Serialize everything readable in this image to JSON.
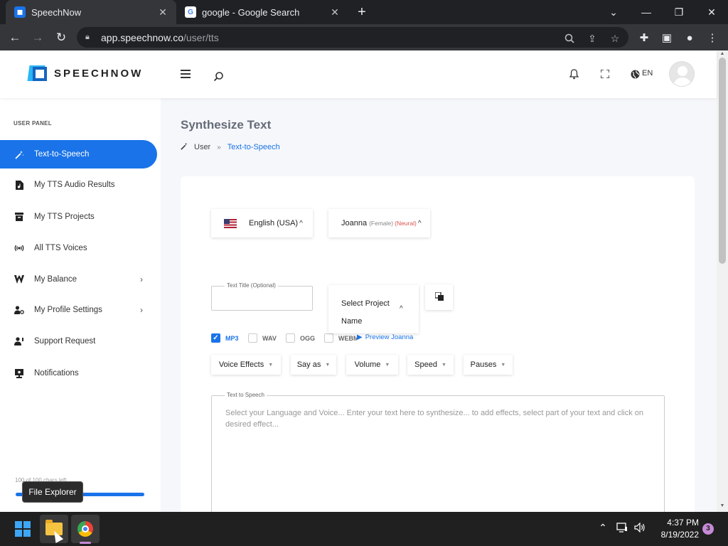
{
  "browser": {
    "tabs": [
      {
        "title": "SpeechNow",
        "favicon": "speechnow-icon",
        "close": "✕"
      },
      {
        "title": "google - Google Search",
        "favicon": "google-icon",
        "close": "✕"
      }
    ],
    "new_tab": "+",
    "url_host": "app.speechnow.co",
    "url_path": "/user/tts"
  },
  "header": {
    "logo_text": "SPEECHNOW",
    "lang": "EN"
  },
  "sidebar": {
    "panel_label": "USER PANEL",
    "items": [
      {
        "label": "Text-to-Speech",
        "icon": "magic-wand-icon"
      },
      {
        "label": "My TTS Audio Results",
        "icon": "audio-file-icon"
      },
      {
        "label": "My TTS Projects",
        "icon": "archive-icon"
      },
      {
        "label": "All TTS Voices",
        "icon": "broadcast-icon"
      },
      {
        "label": "My Balance",
        "icon": "wallet-icon"
      },
      {
        "label": "My Profile Settings",
        "icon": "user-gear-icon"
      },
      {
        "label": "Support Request",
        "icon": "user-help-icon"
      },
      {
        "label": "Notifications",
        "icon": "notification-icon"
      }
    ],
    "chars_left": "100 of 100 chars left",
    "chars_progress_percent": 100
  },
  "tooltip": "File Explorer",
  "main": {
    "title": "Synthesize Text",
    "breadcrumb": {
      "root": "User",
      "sep": "»",
      "current": "Text-to-Speech"
    },
    "language": "English (USA)",
    "voice": {
      "name": "Joanna",
      "gender": "(Female)",
      "engine": "(Neural)"
    },
    "formats": [
      {
        "label": "MP3",
        "checked": true
      },
      {
        "label": "WAV",
        "checked": false
      },
      {
        "label": "OGG",
        "checked": false
      },
      {
        "label": "WEBM",
        "checked": false
      }
    ],
    "preview_label": "Preview Joanna",
    "title_field_label": "Text Title (Optional)",
    "title_field_value": "",
    "project_select": "Select Project Name",
    "effects": [
      "Voice Effects",
      "Say as",
      "Volume",
      "Speed",
      "Pauses"
    ],
    "tts_label": "Text to Speech",
    "tts_placeholder": "Select your Language and Voice... Enter your text here to synthesize... to add effects, select part of your text and click on desired effect..."
  },
  "taskbar": {
    "time": "4:37 PM",
    "date": "8/19/2022",
    "notifications": "3"
  }
}
